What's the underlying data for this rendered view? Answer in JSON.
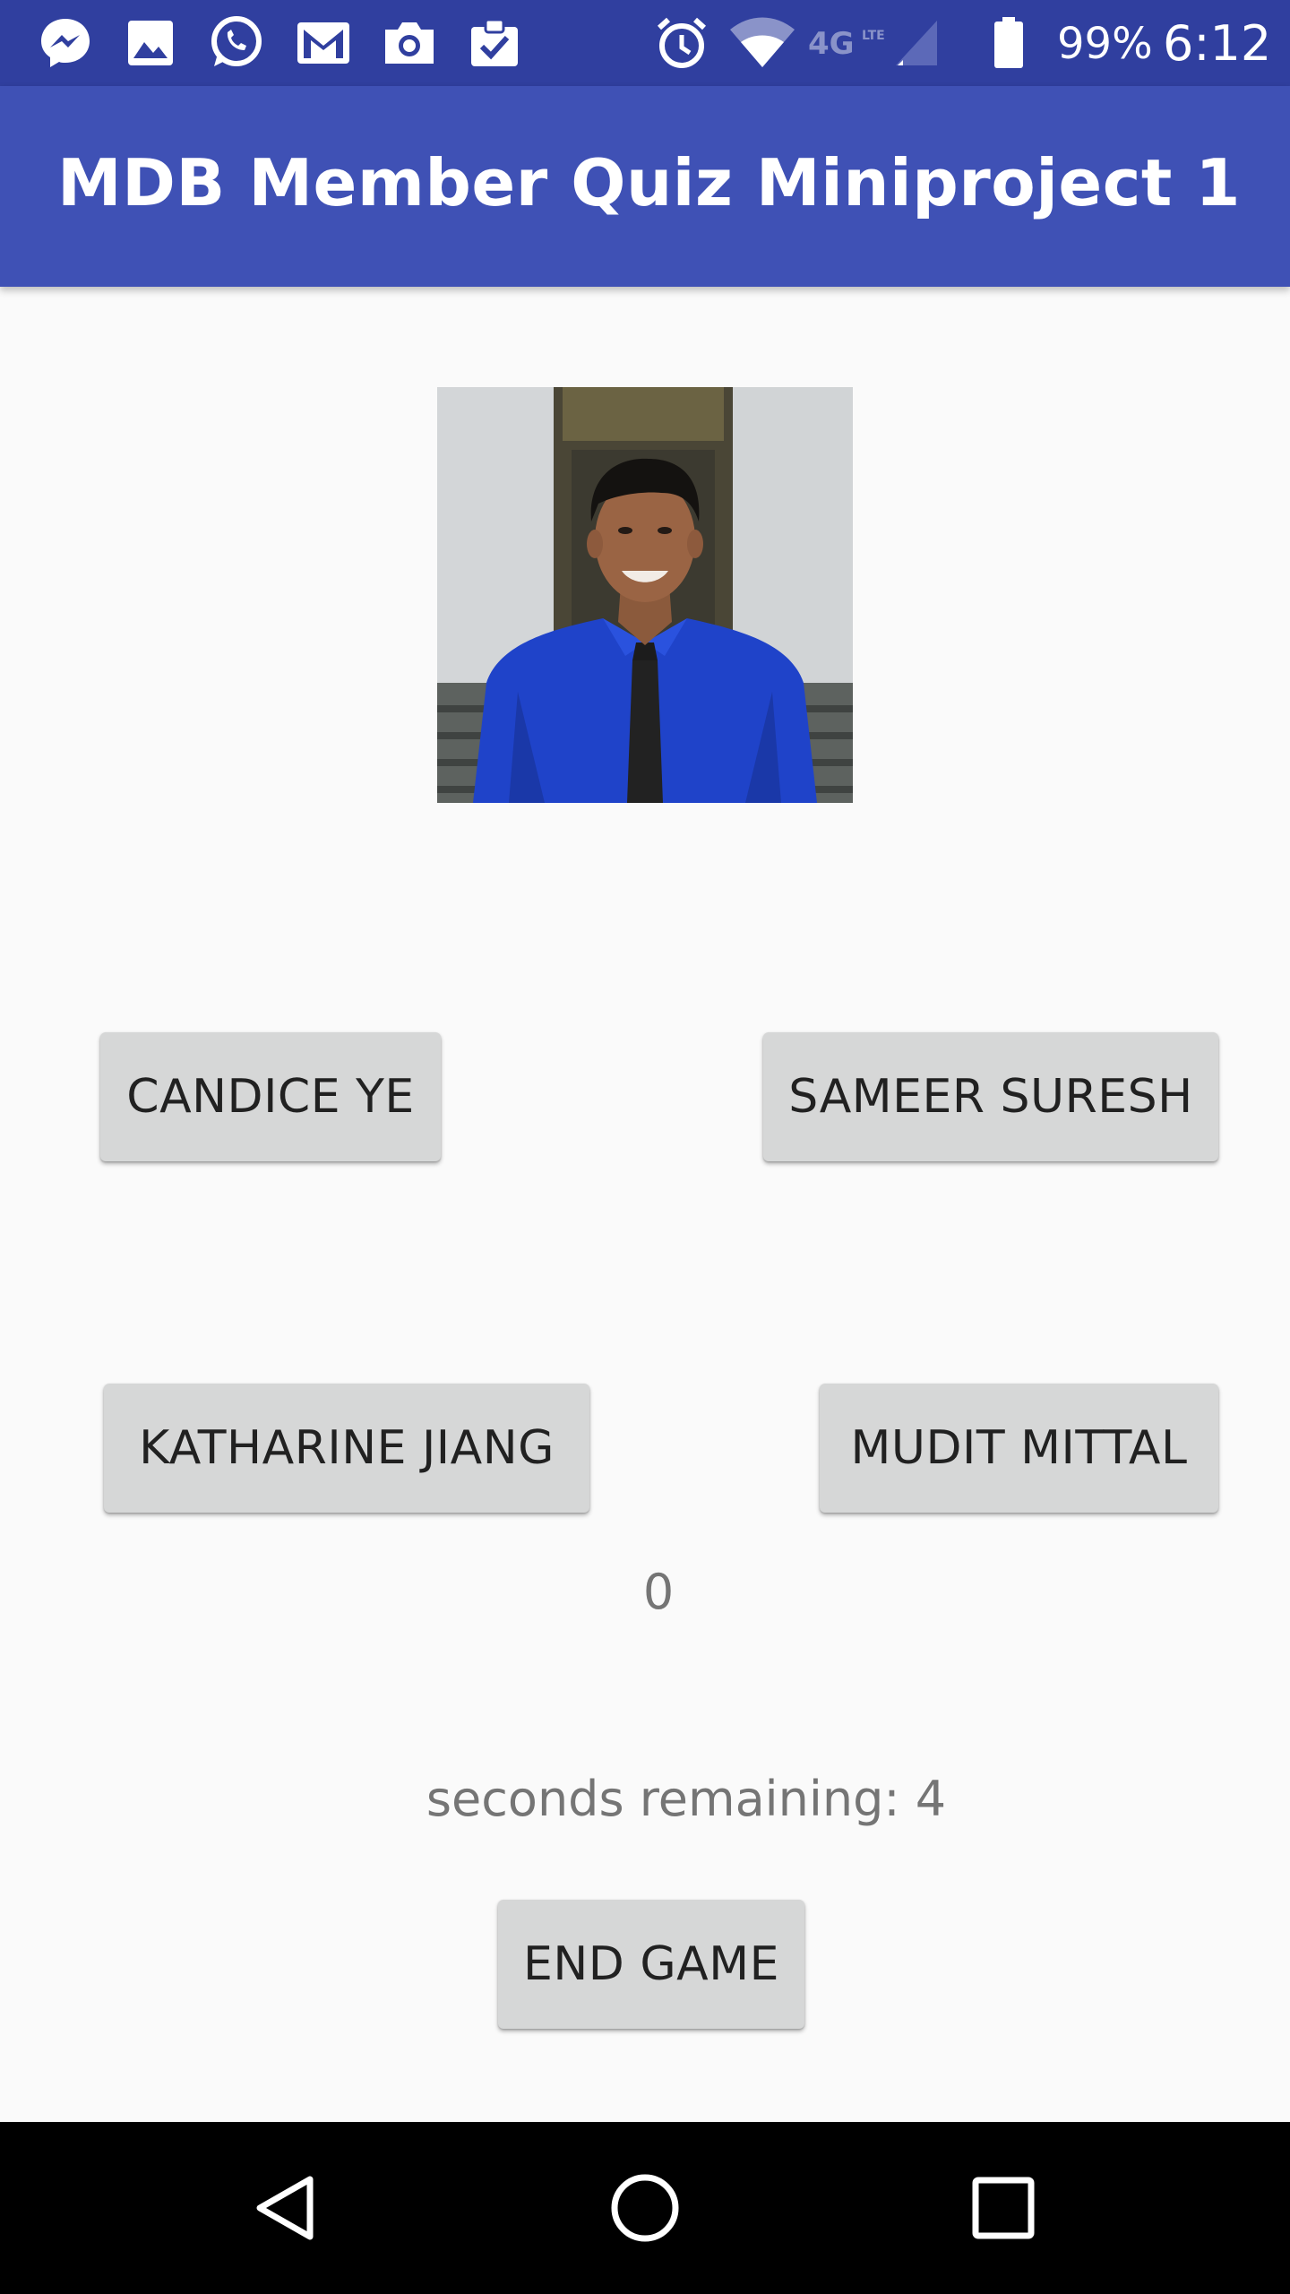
{
  "status_bar": {
    "battery": "99%",
    "time": "6:12",
    "network": "4G LTE",
    "icons": [
      "messenger-icon",
      "gallery-icon",
      "whatsapp-icon",
      "gmail-icon",
      "camera-icon",
      "clipboard-check-icon",
      "alarm-icon",
      "wifi-icon",
      "cell-signal-icon",
      "battery-icon"
    ]
  },
  "app_bar": {
    "title": "MDB Member Quiz Miniproject 1"
  },
  "quiz": {
    "options": [
      "CANDICE YE",
      "SAMEER SURESH",
      "KATHARINE JIANG",
      "MUDIT MITTAL"
    ],
    "score": "0",
    "timer_text": "seconds remaining: 4",
    "end_game_label": "END GAME"
  },
  "colors": {
    "status_bar": "#303f9f",
    "app_bar": "#3f51b5",
    "button": "#d6d7d7",
    "background": "#fafafa"
  }
}
